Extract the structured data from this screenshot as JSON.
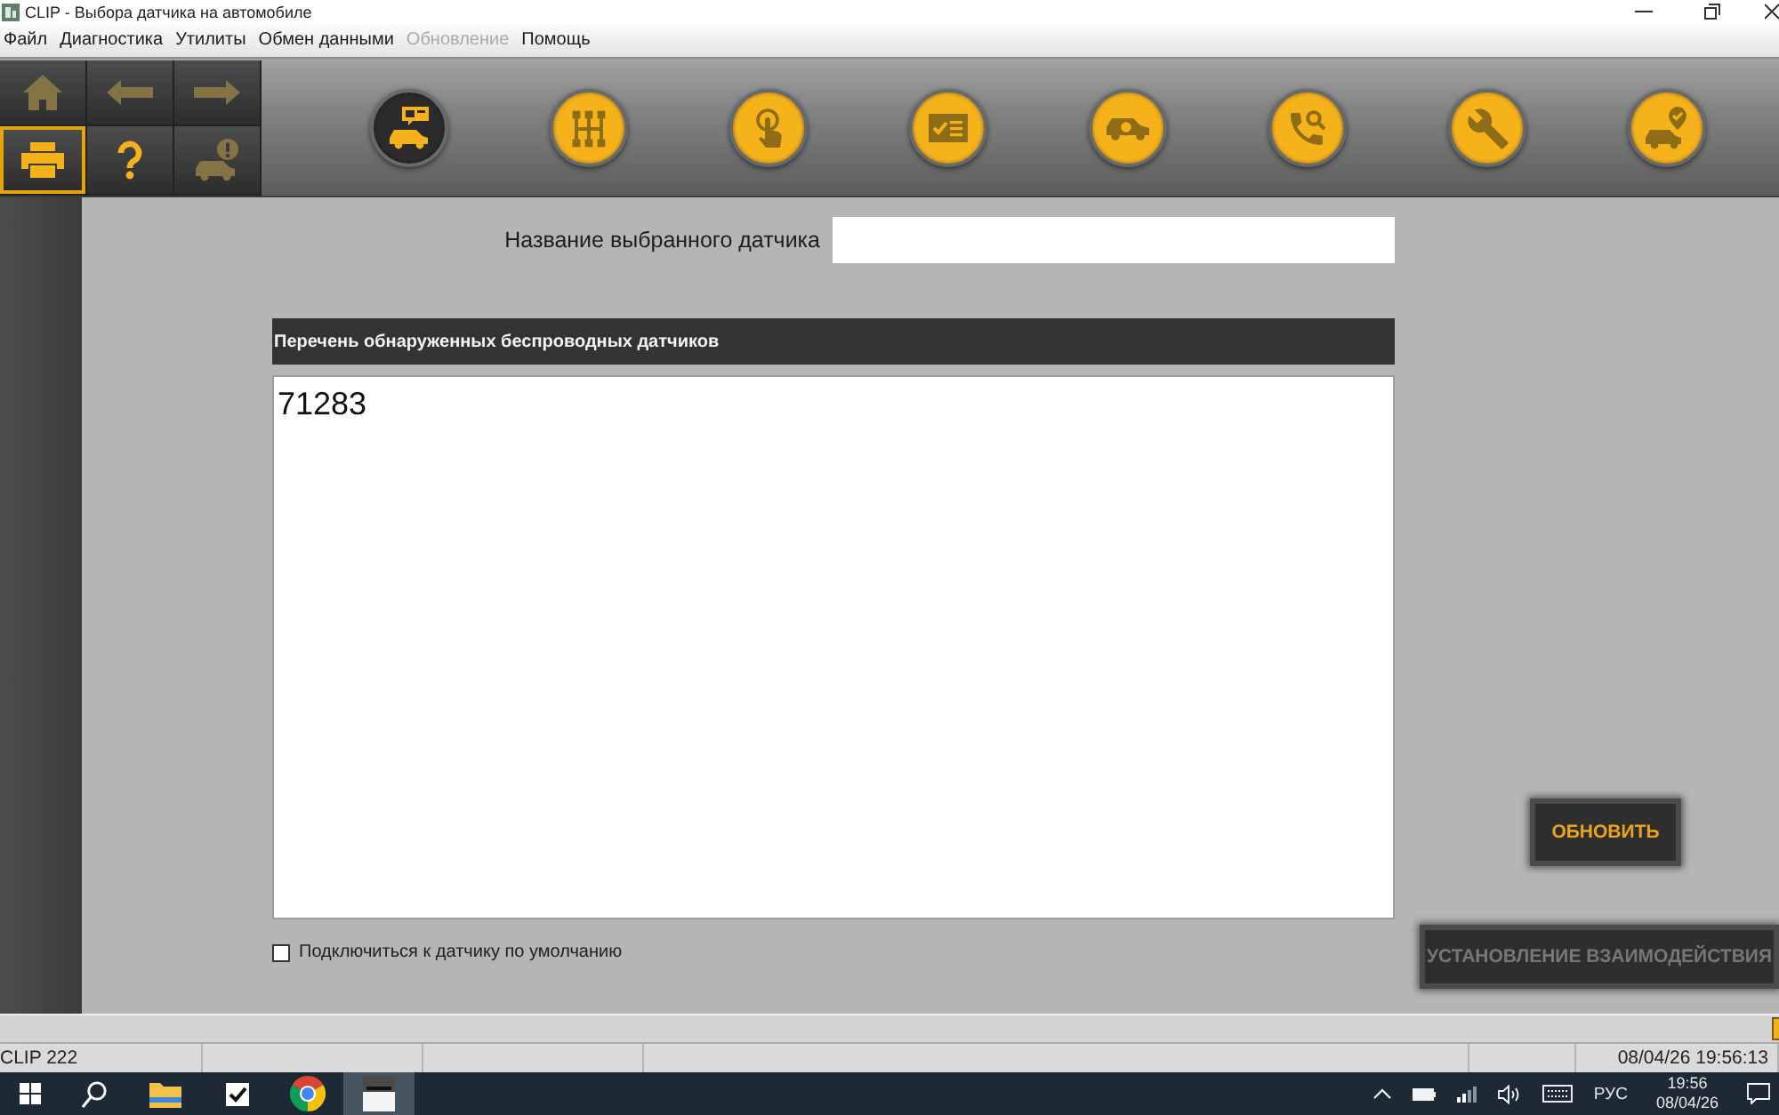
{
  "window": {
    "title": "CLIP - Выбора датчика на автомобиле"
  },
  "menu": [
    {
      "label": "Файл",
      "disabled": false
    },
    {
      "label": "Диагностика",
      "disabled": false
    },
    {
      "label": "Утилиты",
      "disabled": false
    },
    {
      "label": "Обмен данными",
      "disabled": false
    },
    {
      "label": "Обновление",
      "disabled": true
    },
    {
      "label": "Помощь",
      "disabled": false
    }
  ],
  "nav_buttons": [
    {
      "kind": "home",
      "disabled": true,
      "selected": false
    },
    {
      "kind": "back",
      "disabled": true,
      "selected": false
    },
    {
      "kind": "forward",
      "disabled": true,
      "selected": false
    },
    {
      "kind": "print",
      "disabled": false,
      "selected": true
    },
    {
      "kind": "help",
      "disabled": false,
      "selected": false
    },
    {
      "kind": "vehicle-alert",
      "disabled": true,
      "selected": false
    }
  ],
  "modules": [
    {
      "kind": "vehicle-message",
      "selected": true
    },
    {
      "kind": "gearshift",
      "selected": false
    },
    {
      "kind": "touch",
      "selected": false
    },
    {
      "kind": "checklist",
      "selected": false
    },
    {
      "kind": "vehicle-search",
      "selected": false
    },
    {
      "kind": "phone-search",
      "selected": false
    },
    {
      "kind": "wrench",
      "selected": false
    },
    {
      "kind": "vehicle-check",
      "selected": false
    }
  ],
  "sensor_name": {
    "label": "Название выбранного датчика"
  },
  "sensor_list": {
    "title": "Перечень обнаруженных беспроводных датчиков",
    "items": [
      {
        "label": "71283",
        "selected": false
      }
    ]
  },
  "default_sensor": {
    "label": "Подключиться к датчику по умолчанию",
    "checked": false
  },
  "refresh_button": {
    "label": "ОБНОВИТЬ",
    "disabled": false
  },
  "connect_button": {
    "label": "УСТАНОВЛЕНИЕ ВЗАИМОДЕЙСТВИЯ",
    "disabled": true
  },
  "status_bar": {
    "left": "CLIP 222",
    "right": "08/04/26 19:56:13"
  },
  "taskbar": {
    "apps": [
      {
        "kind": "file-explorer",
        "selected": false
      },
      {
        "kind": "tasks",
        "selected": false
      },
      {
        "kind": "browser",
        "selected": false
      },
      {
        "kind": "clip",
        "selected": true
      }
    ],
    "language": "РУС",
    "time": "19:56",
    "date": "08/04/26"
  }
}
